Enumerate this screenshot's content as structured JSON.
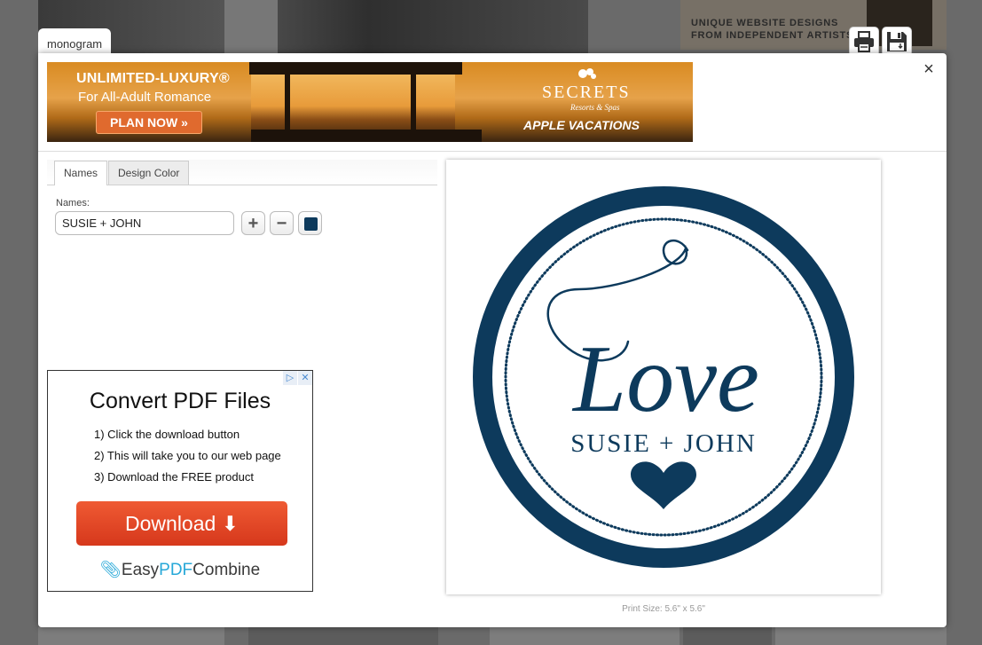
{
  "background": {
    "ad_text": "UNIQUE WEBSITE DESIGNS FROM INDEPENDENT ARTISTS"
  },
  "modal": {
    "title_tab": "monogram",
    "close_label": "×",
    "print_icon": "printer-icon",
    "save_icon": "floppy-disk-icon"
  },
  "banner": {
    "headline": "UNLIMITED-LUXURY®",
    "subline": "For All-Adult Romance",
    "cta": "PLAN NOW »",
    "brand": "SECRETS",
    "brand_sub": "Resorts & Spas",
    "partner": "APPLE VACATIONS"
  },
  "editor": {
    "tabs": [
      {
        "label": "Names",
        "active": true
      },
      {
        "label": "Design Color",
        "active": false
      }
    ],
    "names_label": "Names:",
    "names_value": "SUSIE + JOHN",
    "add_label": "+",
    "remove_label": "−",
    "color": "#0d3a5c"
  },
  "ad": {
    "choices": [
      "▷",
      "✕"
    ],
    "title": "Convert PDF Files",
    "steps": [
      "1) Click the download button",
      "2) This will take you to our web page",
      "3) Download the FREE product"
    ],
    "button": "Download ⬇",
    "brand_prefix": "Easy",
    "brand_accent": "PDF",
    "brand_suffix": "Combine"
  },
  "preview": {
    "script_text": "Love",
    "names": "SUSIE + JOHN",
    "color": "#0d3a5c",
    "print_size": "Print Size: 5.6\" x 5.6\""
  }
}
